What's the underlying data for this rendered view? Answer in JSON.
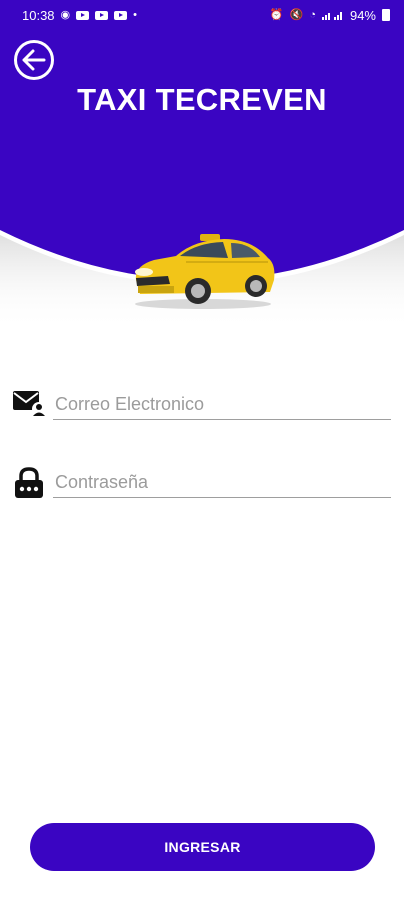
{
  "status_bar": {
    "time": "10:38",
    "battery": "94%"
  },
  "header": {
    "title": "TAXI TECREVEN"
  },
  "form": {
    "email_placeholder": "Correo Electronico",
    "password_placeholder": "Contraseña"
  },
  "actions": {
    "login_label": "INGRESAR"
  },
  "colors": {
    "brand": "#3a05c2",
    "taxi_yellow": "#f2c518"
  },
  "icons": {
    "back": "arrow-left-circle-icon",
    "email": "envelope-user-icon",
    "password": "padlock-icon"
  }
}
